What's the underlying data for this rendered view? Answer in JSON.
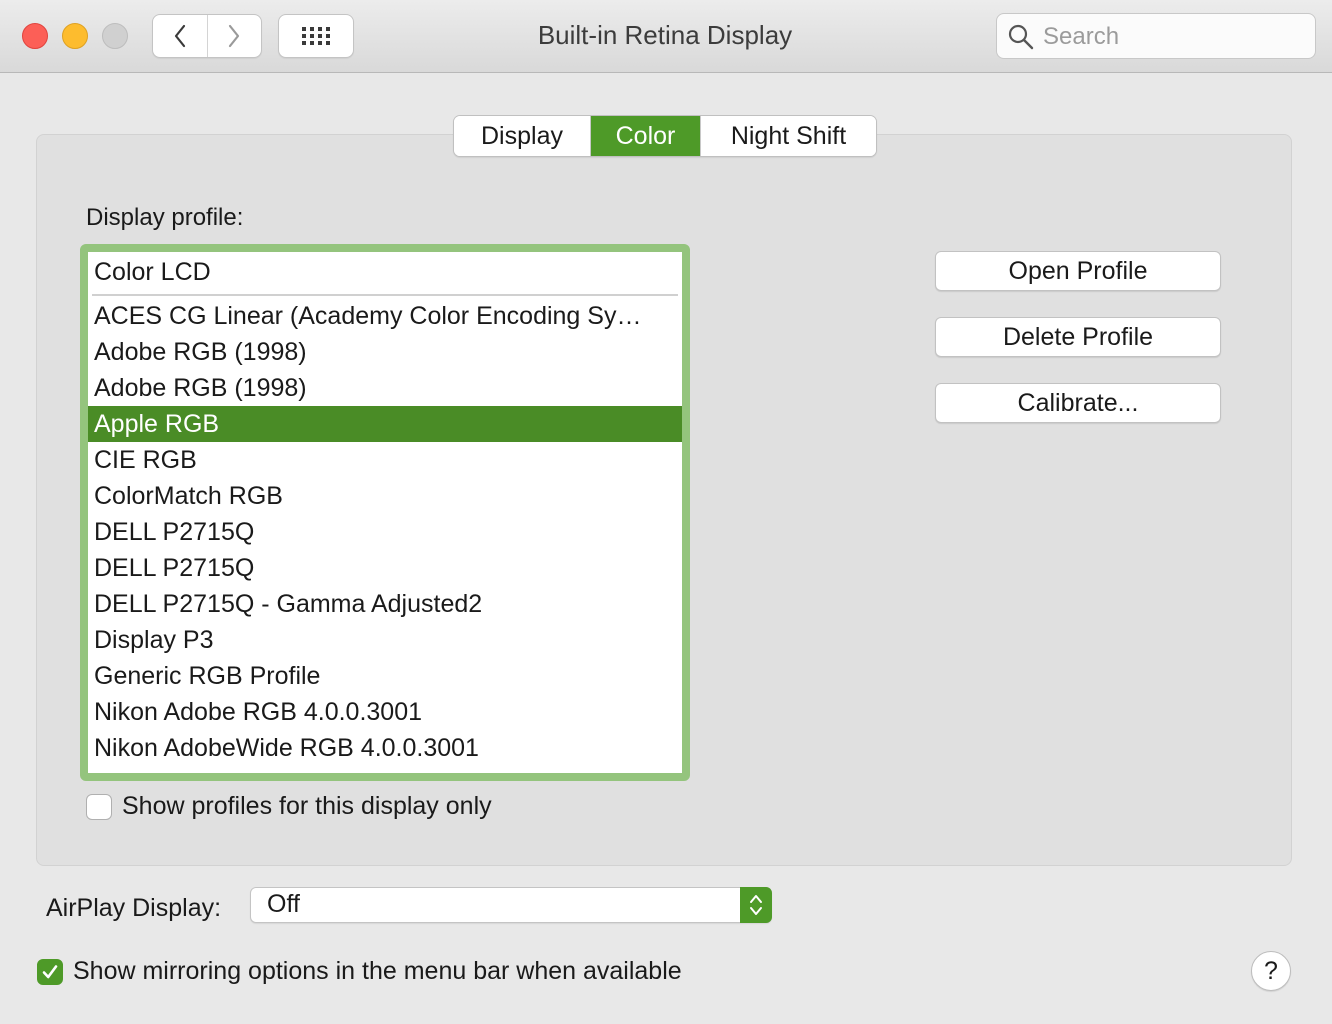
{
  "window": {
    "title": "Built-in Retina Display"
  },
  "toolbar": {
    "back_icon": "chevron-left-icon",
    "forward_icon": "chevron-right-icon",
    "grid_icon": "grid-icon",
    "search_placeholder": "Search"
  },
  "tabs": [
    {
      "label": "Display",
      "active": false
    },
    {
      "label": "Color",
      "active": true
    },
    {
      "label": "Night Shift",
      "active": false
    }
  ],
  "profile": {
    "label": "Display profile:",
    "current": "Color LCD",
    "items": [
      "ACES CG Linear (Academy Color Encoding Sy…",
      "Adobe RGB (1998)",
      "Adobe RGB (1998)",
      "Apple RGB",
      "CIE RGB",
      "ColorMatch RGB",
      "DELL P2715Q",
      "DELL P2715Q",
      "DELL P2715Q - Gamma Adjusted2",
      "Display P3",
      "Generic RGB Profile",
      "Nikon Adobe RGB 4.0.0.3001",
      "Nikon AdobeWide RGB 4.0.0.3001"
    ],
    "selected": "Apple RGB",
    "show_only_label": "Show profiles for this display only",
    "show_only_checked": false
  },
  "buttons": {
    "open": "Open Profile",
    "delete": "Delete Profile",
    "calibrate": "Calibrate..."
  },
  "airplay": {
    "label": "AirPlay Display:",
    "value": "Off"
  },
  "mirroring": {
    "label": "Show mirroring options in the menu bar when available",
    "checked": true
  },
  "help": {
    "label": "?"
  },
  "colors": {
    "accent": "#4e9a28",
    "focus_ring": "#94c47d",
    "selection": "#4a8c26"
  }
}
